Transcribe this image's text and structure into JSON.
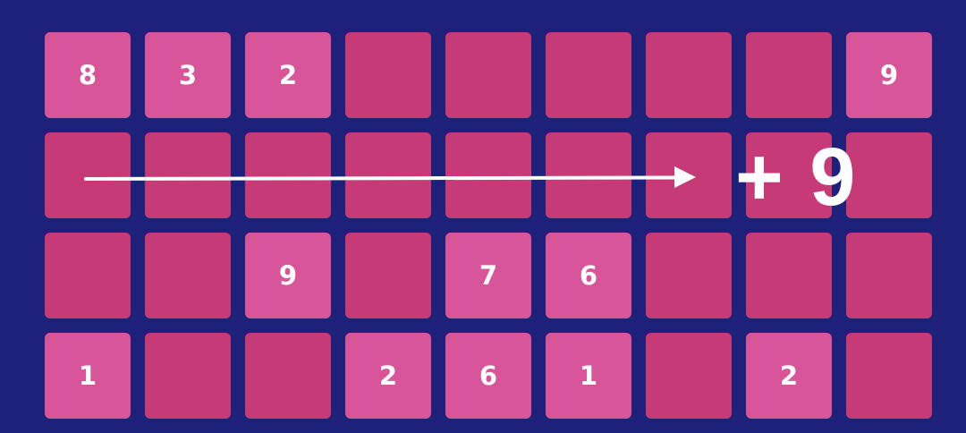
{
  "board": {
    "rows": [
      [
        "8",
        "3",
        "2",
        "",
        "",
        "",
        "",
        "",
        "9"
      ],
      [
        "",
        "",
        "",
        "",
        "",
        "",
        "",
        "",
        ""
      ],
      [
        "",
        "",
        "9",
        "",
        "7",
        "6",
        "",
        "",
        ""
      ],
      [
        "1",
        "",
        "",
        "2",
        "6",
        "1",
        "",
        "2",
        ""
      ]
    ]
  },
  "overlay": {
    "bonus_text": "+ 9"
  },
  "colors": {
    "background": "#1e2179",
    "empty_cell": "#c63a78",
    "filled_cell": "#d9559a",
    "text": "#ffffff"
  }
}
